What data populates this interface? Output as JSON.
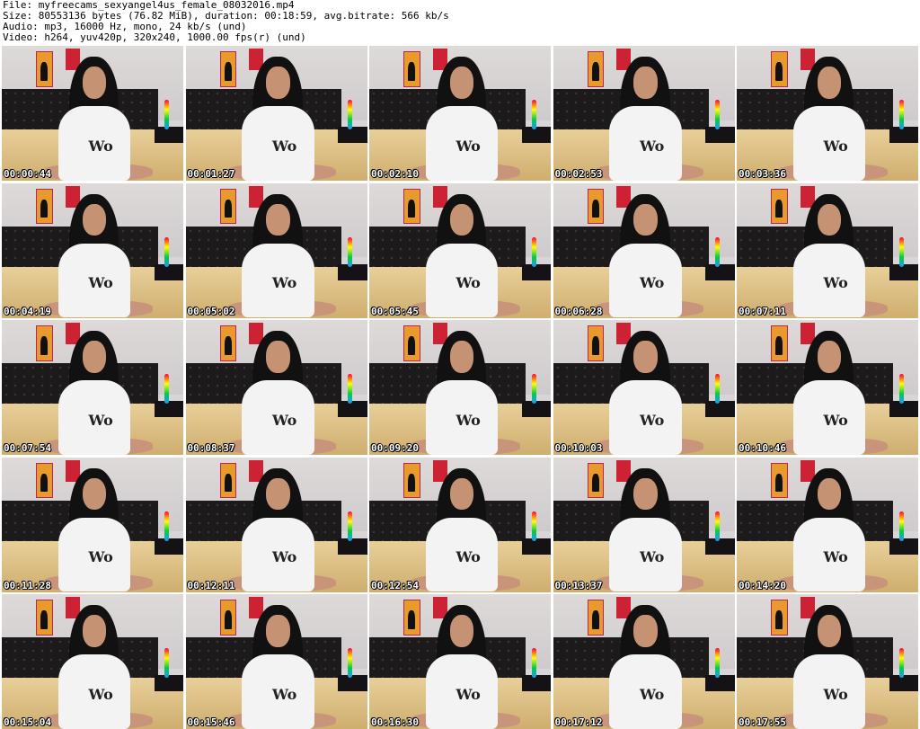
{
  "header": {
    "file": "File: myfreecams_sexyangel4us_female_08032016.mp4",
    "size": "Size: 80553136 bytes (76.82 MiB), duration: 00:18:59, avg.bitrate: 566 kb/s",
    "audio": "Audio: mp3, 16000 Hz, mono, 24 kb/s (und)",
    "video": "Video: h264, yuv420p, 320x240, 1000.00 fps(r) (und)"
  },
  "thumbnails": [
    {
      "timestamp": "00:00:44"
    },
    {
      "timestamp": "00:01:27"
    },
    {
      "timestamp": "00:02:10"
    },
    {
      "timestamp": "00:02:53"
    },
    {
      "timestamp": "00:03:36"
    },
    {
      "timestamp": "00:04:19"
    },
    {
      "timestamp": "00:05:02"
    },
    {
      "timestamp": "00:05:45"
    },
    {
      "timestamp": "00:06:28"
    },
    {
      "timestamp": "00:07:11"
    },
    {
      "timestamp": "00:07:54"
    },
    {
      "timestamp": "00:08:37"
    },
    {
      "timestamp": "00:09:20"
    },
    {
      "timestamp": "00:10:03"
    },
    {
      "timestamp": "00:10:46"
    },
    {
      "timestamp": "00:11:28"
    },
    {
      "timestamp": "00:12:11"
    },
    {
      "timestamp": "00:12:54"
    },
    {
      "timestamp": "00:13:37"
    },
    {
      "timestamp": "00:14:20"
    },
    {
      "timestamp": "00:15:04"
    },
    {
      "timestamp": "00:15:46"
    },
    {
      "timestamp": "00:16:30"
    },
    {
      "timestamp": "00:17:12"
    },
    {
      "timestamp": "00:17:55"
    }
  ]
}
